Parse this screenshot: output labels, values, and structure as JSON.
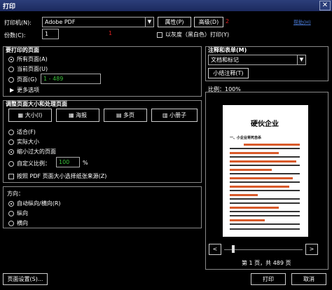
{
  "title": "打印",
  "printer": {
    "label": "打印机(N):",
    "value": "Adobe PDF",
    "properties": "属性(P)",
    "advanced": "高级(D)",
    "help_link": "帮助(H)"
  },
  "copies": {
    "label": "份数(C):",
    "value": "1",
    "grayscale": "以灰度（黑白色）打印(Y)"
  },
  "annotations": {
    "title": "注释和表单(M)",
    "value": "文档和标记",
    "summary_btn": "小结注释(T)"
  },
  "pages_to_print": {
    "title": "要打印的页面",
    "all": "所有页面(A)",
    "current": "当前页面(U)",
    "pages": "页面(G)",
    "range": "1 - 489",
    "more": "更多选项"
  },
  "size_handling": {
    "title": "调整页面大小和处理页面",
    "tabs": [
      "大小(I)",
      "海报",
      "多页",
      "小册子"
    ],
    "fit": "适合(F)",
    "actual": "实际大小",
    "shrink": "缩小过大的页面",
    "custom": "自定义比例：",
    "custom_value": "100",
    "percent": "%",
    "choose_paper": "按照 PDF 页面大小选择纸张来源(Z)"
  },
  "orientation": {
    "title": "方向：",
    "auto": "自动纵向/横向(R)",
    "portrait": "纵向",
    "landscape": "横向"
  },
  "preview": {
    "scale": "比例：100%",
    "doc_title": "硬伙企业",
    "doc_subtitle": "一、小企业将死自杀",
    "page_info": "第 1 页，共 489 页",
    "prev": "<",
    "next": ">"
  },
  "footer": {
    "page_setup": "页面设置(S)...",
    "print": "打印",
    "cancel": "取消"
  },
  "markers": {
    "m1": "1",
    "m2": "2"
  }
}
